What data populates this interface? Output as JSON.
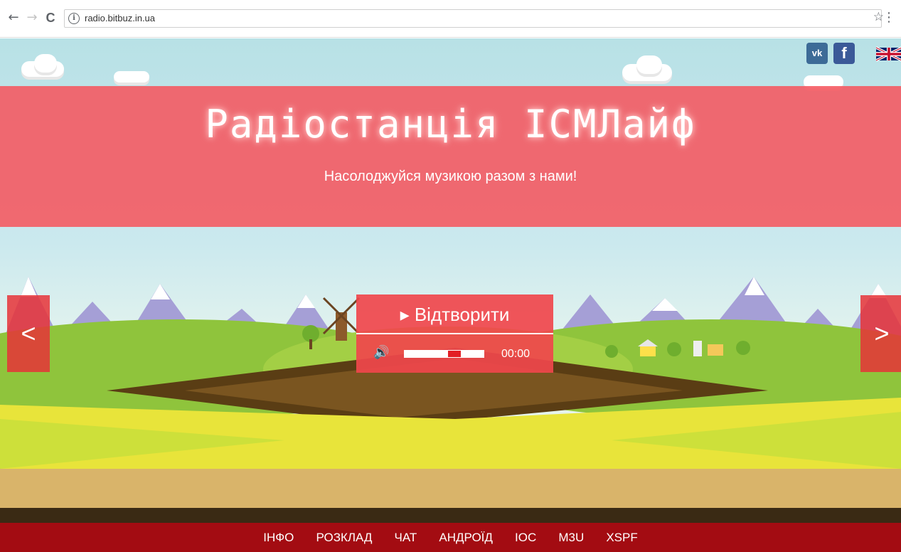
{
  "browser": {
    "url": "radio.bitbuz.in.ua",
    "back_icon": "←",
    "forward_icon": "→",
    "reload_icon": "C",
    "info_icon": "i",
    "star_icon": "☆",
    "menu_icon": "⋮"
  },
  "social": {
    "vk_label": "vk",
    "fb_label": "f"
  },
  "header": {
    "title": "Радіостанція ІСМЛайф",
    "subtitle": "Насолоджуйся музикою разом з нами!"
  },
  "carousel": {
    "prev_label": "<",
    "next_label": ">"
  },
  "player": {
    "play_label": "▸ Відтворити",
    "volume_icon": "🔊",
    "volume_level": 0.65,
    "time": "00:00"
  },
  "footer": {
    "links": [
      "ІНФО",
      "РОЗКЛАД",
      "ЧАТ",
      "АНДРОЇД",
      "ІОС",
      "M3U",
      "XSPF"
    ]
  },
  "colors": {
    "banner": "#f5565e",
    "accent": "#e31e25",
    "footer": "#a30c12"
  }
}
